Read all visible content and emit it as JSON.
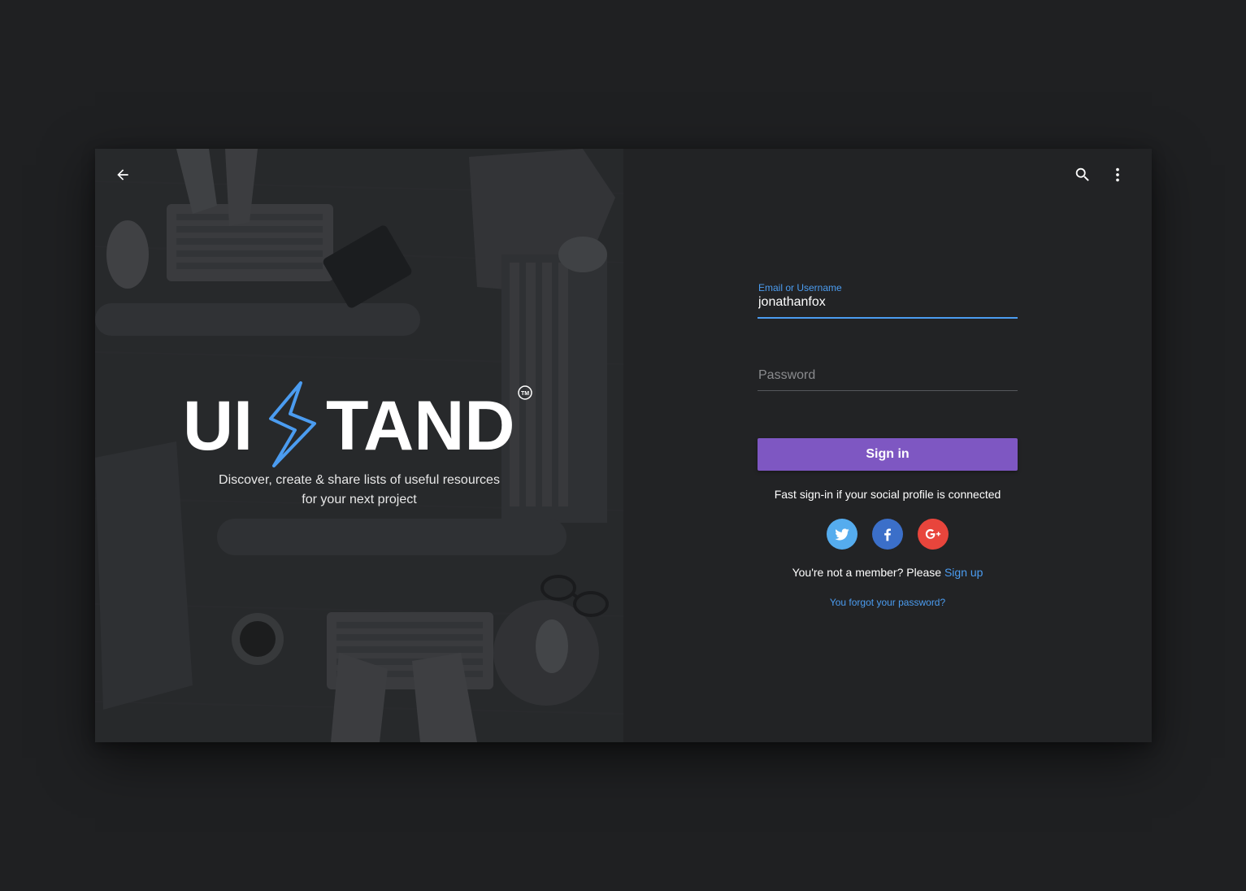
{
  "hero": {
    "brand_letters_left": "UI",
    "brand_letters_right": "TAND",
    "trademark": "TM",
    "tagline_line1": "Discover, create & share lists of useful resources",
    "tagline_line2": "for your next project",
    "back_icon": "arrow-left-icon"
  },
  "toolbar": {
    "search_icon": "search-icon",
    "menu_icon": "more-vert-icon"
  },
  "login": {
    "email_label": "Email or Username",
    "email_value": "jonathanfox",
    "password_placeholder": "Password",
    "signin_label": "Sign in",
    "fast_signin_text": "Fast sign-in if your social profile is connected",
    "social": [
      {
        "name": "twitter",
        "icon": "twitter-icon",
        "color": "#55acee"
      },
      {
        "name": "facebook",
        "icon": "facebook-icon",
        "color": "#3b6fc9"
      },
      {
        "name": "google-plus",
        "icon": "google-plus-icon",
        "color": "#e8453c"
      }
    ],
    "member_prefix": "You're not a member? Please ",
    "signup_link": "Sign up",
    "forgot_link": "You forgot your password?"
  },
  "colors": {
    "accent_blue": "#4b9cf0",
    "button_purple": "#7e57c2",
    "background": "#222325"
  }
}
